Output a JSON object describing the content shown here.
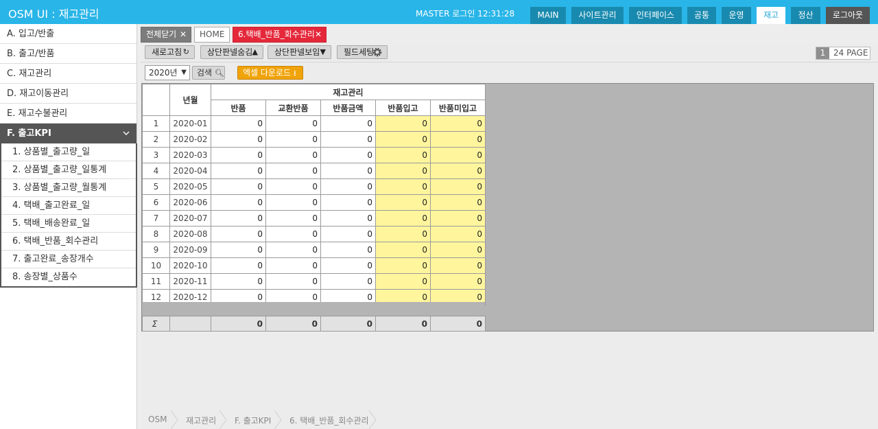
{
  "app": {
    "title": "OSM UI : 재고관리",
    "login_info": "MASTER 로그인 12:31:28"
  },
  "topnav": [
    "MAIN",
    "사이트관리",
    "인터페이스",
    "공통",
    "운영",
    "재고",
    "정산",
    "로그아웃"
  ],
  "sidebar": {
    "items": [
      "A. 입고/반출",
      "B. 출고/반품",
      "C. 재고관리",
      "D. 재고이동관리",
      "E. 재고수불관리",
      "F. 출고KPI"
    ],
    "submenu": [
      "1. 상품별_출고량_일",
      "2. 상품별_출고량_일통계",
      "3. 상품별_출고량_월통계",
      "4. 택배_출고완료_일",
      "5. 택배_배송완료_일",
      "6. 택배_반품_회수관리",
      "7. 출고완료_송장개수",
      "8. 송장별_상품수"
    ]
  },
  "tabs": {
    "close_all": "전체닫기",
    "home": "HOME",
    "active": "6.택배_반품_회수관리"
  },
  "toolbar": {
    "refresh": "새로고침",
    "hide_panel": "상단판넬숨김",
    "show_panel": "상단판넬보임",
    "field_setting": "필드세팅",
    "page_num": "1",
    "page_label": "24 PAGE"
  },
  "filter": {
    "year": "2020년",
    "search": "검색",
    "excel": "엑셀 다운로드"
  },
  "grid": {
    "group_header": "재고관리",
    "col_yearmonth": "년월",
    "columns": [
      "반품",
      "교환반품",
      "반품금액",
      "반품입고",
      "반품미입고"
    ],
    "rows": [
      {
        "no": "1",
        "ym": "2020-01",
        "v": [
          "0",
          "0",
          "0",
          "0",
          "0"
        ]
      },
      {
        "no": "2",
        "ym": "2020-02",
        "v": [
          "0",
          "0",
          "0",
          "0",
          "0"
        ]
      },
      {
        "no": "3",
        "ym": "2020-03",
        "v": [
          "0",
          "0",
          "0",
          "0",
          "0"
        ]
      },
      {
        "no": "4",
        "ym": "2020-04",
        "v": [
          "0",
          "0",
          "0",
          "0",
          "0"
        ]
      },
      {
        "no": "5",
        "ym": "2020-05",
        "v": [
          "0",
          "0",
          "0",
          "0",
          "0"
        ]
      },
      {
        "no": "6",
        "ym": "2020-06",
        "v": [
          "0",
          "0",
          "0",
          "0",
          "0"
        ]
      },
      {
        "no": "7",
        "ym": "2020-07",
        "v": [
          "0",
          "0",
          "0",
          "0",
          "0"
        ]
      },
      {
        "no": "8",
        "ym": "2020-08",
        "v": [
          "0",
          "0",
          "0",
          "0",
          "0"
        ]
      },
      {
        "no": "9",
        "ym": "2020-09",
        "v": [
          "0",
          "0",
          "0",
          "0",
          "0"
        ]
      },
      {
        "no": "10",
        "ym": "2020-10",
        "v": [
          "0",
          "0",
          "0",
          "0",
          "0"
        ]
      },
      {
        "no": "11",
        "ym": "2020-11",
        "v": [
          "0",
          "0",
          "0",
          "0",
          "0"
        ]
      },
      {
        "no": "12",
        "ym": "2020-12",
        "v": [
          "0",
          "0",
          "0",
          "0",
          "0"
        ]
      }
    ],
    "sum_symbol": "Σ",
    "sum": [
      "0",
      "0",
      "0",
      "0",
      "0"
    ]
  },
  "breadcrumb": [
    "OSM",
    "재고관리",
    "F. 출고KPI",
    "6. 택배_반품_회수관리"
  ],
  "colors": {
    "header_bg": "#29b5e8",
    "nav_bg": "#198aaf",
    "active_tab": "#e4283a",
    "excel_btn": "#f0a30a",
    "yellow_cell": "#fff59d"
  }
}
